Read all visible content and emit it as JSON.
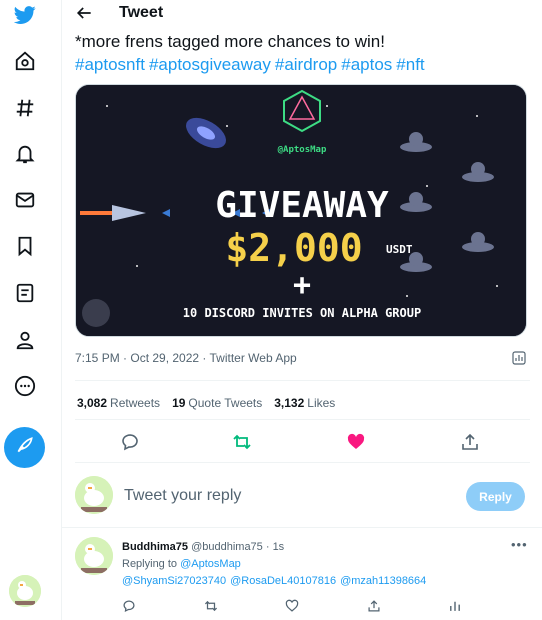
{
  "header": {
    "title": "Tweet"
  },
  "tweet": {
    "text": "*more frens tagged more chances to win!",
    "hashtags": [
      "#aptosnft",
      "#aptosgiveaway",
      "#airdrop",
      "#aptos",
      "#nft"
    ],
    "media": {
      "brand_handle": "@AptosMap",
      "headline": "GIVEAWAY",
      "amount": "$2,000",
      "currency": "USDT",
      "plus": "+",
      "subline": "10 DISCORD INVITES ON ALPHA GROUP"
    },
    "meta": "7:15 PM · Oct 29, 2022 · Twitter Web App",
    "stats": {
      "retweets_count": "3,082",
      "retweets_label": "Retweets",
      "quotes_count": "19",
      "quotes_label": "Quote Tweets",
      "likes_count": "3,132",
      "likes_label": "Likes"
    },
    "liked": true
  },
  "reply_box": {
    "placeholder": "Tweet your reply",
    "button_label": "Reply"
  },
  "reply_tweet": {
    "name": "Buddhima75",
    "handle": "@buddhima75 · 1s",
    "replying_prefix": "Replying to",
    "replying_to": "@AptosMap",
    "mentions": [
      "@ShyamSi27023740",
      "@RosaDeL40107816",
      "@mzah11398664"
    ]
  },
  "colors": {
    "accent": "#1d9bf0",
    "like": "#f91880",
    "retweet": "#00ba7c",
    "muted": "#536471"
  },
  "icons": {
    "sidebar": [
      "twitter-logo-icon",
      "home-icon",
      "explore-hash-icon",
      "notifications-bell-icon",
      "messages-envelope-icon",
      "bookmarks-icon",
      "lists-icon",
      "profile-icon",
      "more-icon",
      "compose-feather-icon"
    ]
  }
}
